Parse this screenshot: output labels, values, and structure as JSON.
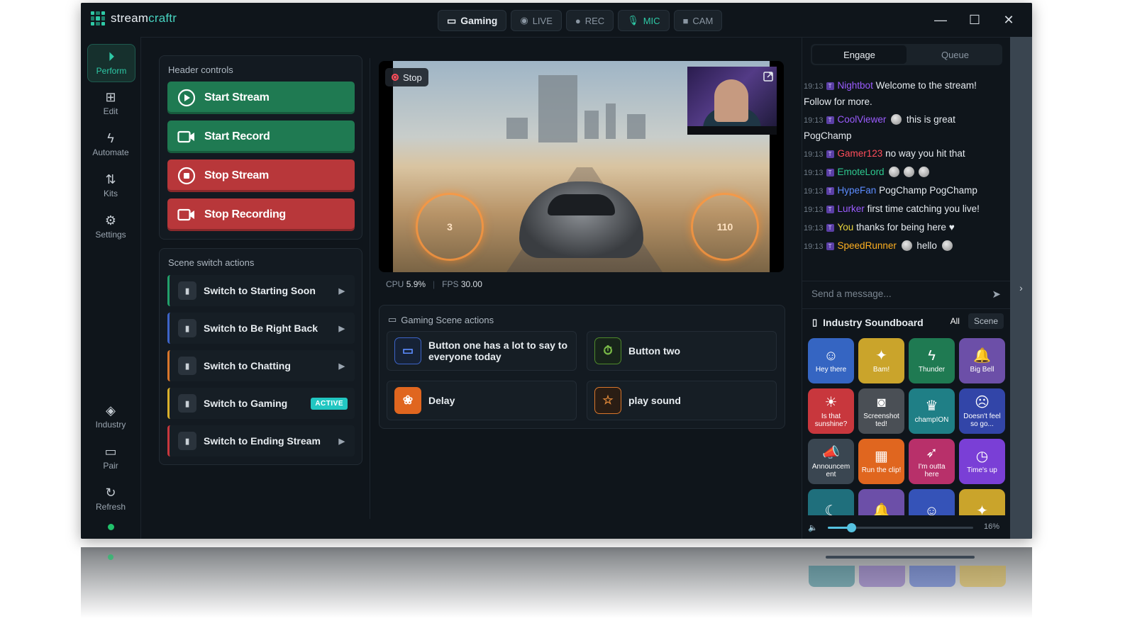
{
  "app": {
    "brand_a": "stream",
    "brand_b": "craftr"
  },
  "topbar": {
    "scene_pill": "Gaming",
    "live": "LIVE",
    "rec": "REC",
    "mic": "MIC",
    "cam": "CAM",
    "minimize": "—",
    "maximize": "☐",
    "close": "✕"
  },
  "nav": {
    "perform": "Perform",
    "edit": "Edit",
    "automate": "Automate",
    "kits": "Kits",
    "settings": "Settings",
    "industry": "Industry",
    "pair": "Pair",
    "refresh": "Refresh"
  },
  "header_controls": {
    "title": "Header controls",
    "start_stream": "Start Stream",
    "start_record": "Start Record",
    "stop_stream": "Stop Stream",
    "stop_recording": "Stop Recording"
  },
  "scene_switch": {
    "title": "Scene switch actions",
    "items": [
      {
        "label": "Switch to Starting Soon",
        "color": "#22a06b"
      },
      {
        "label": "Switch to Be Right Back",
        "color": "#3d64c8"
      },
      {
        "label": "Switch to Chatting",
        "color": "#d9762b"
      },
      {
        "label": "Switch to Gaming",
        "color": "#d9b02b",
        "badge": "ACTIVE"
      },
      {
        "label": "Switch to Ending Stream",
        "color": "#c8373d"
      }
    ]
  },
  "preview": {
    "stop_label": "Stop",
    "cpu_label": "CPU",
    "cpu_value": "5.9%",
    "fps_label": "FPS",
    "fps_value": "30.00",
    "hud_left": "3",
    "hud_right": "110"
  },
  "scene_actions": {
    "title": "Gaming Scene actions",
    "buttons": [
      {
        "label": "Button one has a lot to say to everyone today",
        "icon": "monitor-icon"
      },
      {
        "label": "Button two",
        "icon": "timer-icon"
      },
      {
        "label": "Delay",
        "icon": "paw-icon"
      },
      {
        "label": "play sound",
        "icon": "star-icon"
      }
    ]
  },
  "chat": {
    "tab_engage": "Engage",
    "tab_queue": "Queue",
    "messages": [
      {
        "time": "19:13",
        "badge": "T",
        "user": "Nightbot",
        "color": "#9b5cff",
        "text": "Welcome to the stream! Follow for more."
      },
      {
        "time": "19:13",
        "badge": "T",
        "user": "CoolViewer",
        "color": "#9b5cff",
        "text": "this is great PogChamp"
      },
      {
        "time": "19:13",
        "badge": "T",
        "user": "Gamer123",
        "color": "#ff4d5a",
        "text": "no way you hit that"
      },
      {
        "time": "19:13",
        "badge": "T",
        "user": "EmoteLord",
        "color": "#2ec98f",
        "text": ""
      },
      {
        "time": "19:13",
        "badge": "T",
        "user": "HypeFan",
        "color": "#5c8cff",
        "text": "PogChamp PogChamp"
      },
      {
        "time": "19:13",
        "badge": "T",
        "user": "Lurker",
        "color": "#9b5cff",
        "text": "first time catching you live!"
      },
      {
        "time": "19:13",
        "badge": "T",
        "user": "You",
        "color": "#e8d43b",
        "text": "thanks for being here"
      },
      {
        "time": "19:13",
        "badge": "T",
        "user": "SpeedRunner",
        "color": "#ffb020",
        "text": "hello"
      }
    ],
    "placeholder": "Send a message..."
  },
  "soundboard": {
    "title": "Industry Soundboard",
    "filter_all": "All",
    "filter_scene": "Scene",
    "volume_pct": "16%",
    "volume_value": 16,
    "tiles": [
      {
        "label": "Hey there",
        "bg": "#3565c2",
        "icon": "smile-icon",
        "glyph": "☺"
      },
      {
        "label": "Bam!",
        "bg": "#caa42b",
        "icon": "sparkle-icon",
        "glyph": "✦"
      },
      {
        "label": "Thunder",
        "bg": "#1f7a52",
        "icon": "bolt-icon",
        "glyph": "ϟ"
      },
      {
        "label": "Big Bell",
        "bg": "#6c4fa8",
        "icon": "bell-icon",
        "glyph": "🔔"
      },
      {
        "label": "Is that sunshine?",
        "bg": "#c8373d",
        "icon": "sun-icon",
        "glyph": "☀"
      },
      {
        "label": "Screenshot ted!",
        "bg": "#4a4f55",
        "icon": "camera-icon",
        "glyph": "◙"
      },
      {
        "label": "champION",
        "bg": "#1f7f86",
        "icon": "trophy-icon",
        "glyph": "♛"
      },
      {
        "label": "Doesn't feel so go...",
        "bg": "#3245a8",
        "icon": "sad-icon",
        "glyph": "☹"
      },
      {
        "label": "Announcem ent",
        "bg": "#3a4651",
        "icon": "megaphone-icon",
        "glyph": "📣"
      },
      {
        "label": "Run the clip!",
        "bg": "#e0661f",
        "icon": "film-icon",
        "glyph": "▦"
      },
      {
        "label": "I'm outta here",
        "bg": "#b8306a",
        "icon": "rocket-icon",
        "glyph": "➶"
      },
      {
        "label": "Time's up",
        "bg": "#7a3fd6",
        "icon": "stopwatch-icon",
        "glyph": "◷"
      },
      {
        "label": "",
        "bg": "#1f6f7c",
        "icon": "moon-icon",
        "glyph": "☾"
      },
      {
        "label": "",
        "bg": "#6c4fa8",
        "icon": "bell-icon",
        "glyph": "🔔"
      },
      {
        "label": "",
        "bg": "#3553b8",
        "icon": "smile-icon",
        "glyph": "☺"
      },
      {
        "label": "",
        "bg": "#caa42b",
        "icon": "sparkle-icon",
        "glyph": "✦"
      }
    ]
  }
}
